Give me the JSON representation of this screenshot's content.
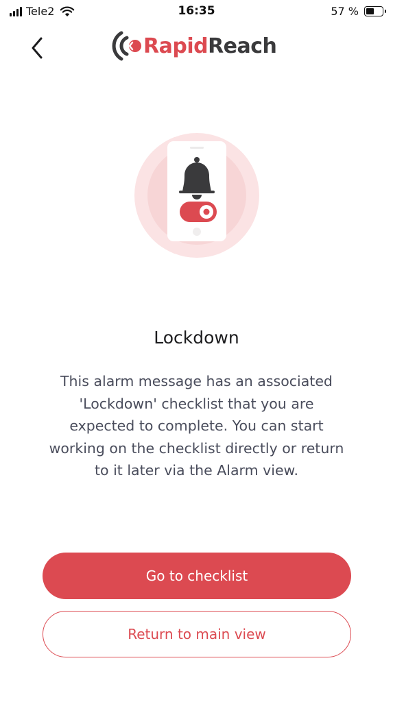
{
  "status_bar": {
    "carrier": "Tele2",
    "time": "16:35",
    "battery": "57 %",
    "battery_level": 0.57
  },
  "header": {
    "back_icon": "chevron-left-icon",
    "logo_part1": "Rapid",
    "logo_part2": "Reach"
  },
  "illustration": {
    "icon": "phone-bell-toggle-icon",
    "colors": {
      "accent": "#dc4a51",
      "bell": "#3a3a3c",
      "halo": "#fbe3e4"
    }
  },
  "content": {
    "title": "Lockdown",
    "message": "This alarm message has an associated 'Lockdown' checklist that you are expected to complete. You can start working on the checklist directly or return to it later via the Alarm view."
  },
  "actions": {
    "primary_label": "Go to checklist",
    "secondary_label": "Return to main view"
  },
  "colors": {
    "brand": "#dc4a51",
    "text_dark": "#1c1c1e",
    "text_body": "#4a4d5c",
    "background": "#ffffff"
  }
}
